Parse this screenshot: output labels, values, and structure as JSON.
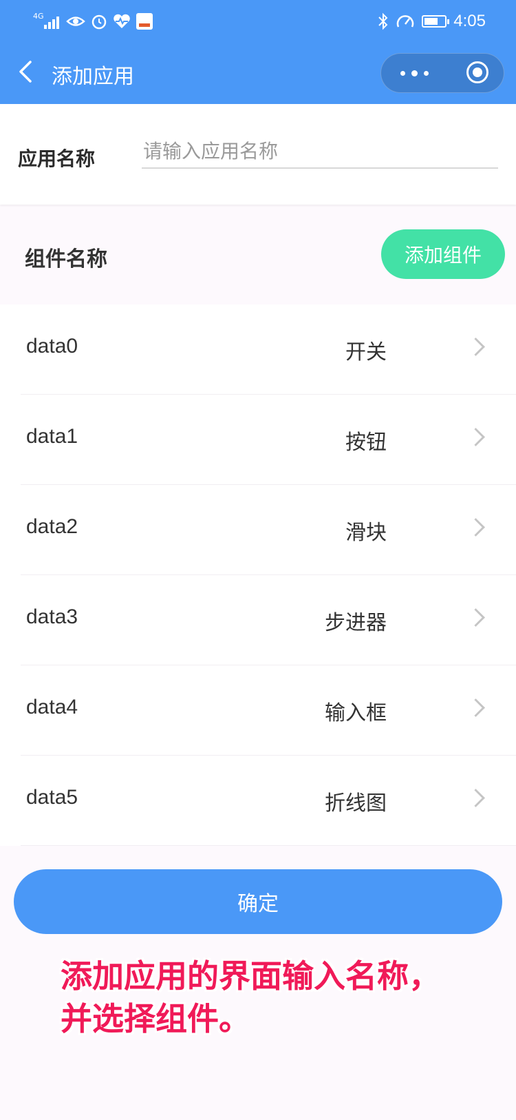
{
  "status_bar": {
    "network": "4G",
    "time": "4:05",
    "icons": [
      "signal-icon",
      "eye-icon",
      "alarm-icon",
      "heart-icon",
      "app-icon",
      "bluetooth-icon",
      "speed-icon",
      "battery-icon"
    ]
  },
  "nav": {
    "title": "添加应用",
    "back_icon": "back-icon",
    "more_icon": "more-icon",
    "close_icon": "close-icon"
  },
  "form": {
    "name_label": "应用名称",
    "name_placeholder": "请输入应用名称",
    "name_value": ""
  },
  "components": {
    "title": "组件名称",
    "add_label": "添加组件",
    "items": [
      {
        "key": "data0",
        "type": "开关"
      },
      {
        "key": "data1",
        "type": "按钮"
      },
      {
        "key": "data2",
        "type": "滑块"
      },
      {
        "key": "data3",
        "type": "步进器"
      },
      {
        "key": "data4",
        "type": "输入框"
      },
      {
        "key": "data5",
        "type": "折线图"
      }
    ]
  },
  "confirm_label": "确定",
  "caption": "添加应用的界面输入名称，\n并选择组件。",
  "colors": {
    "primary": "#4a98f7",
    "accent": "#43e1a6",
    "caption": "#f01a58"
  }
}
